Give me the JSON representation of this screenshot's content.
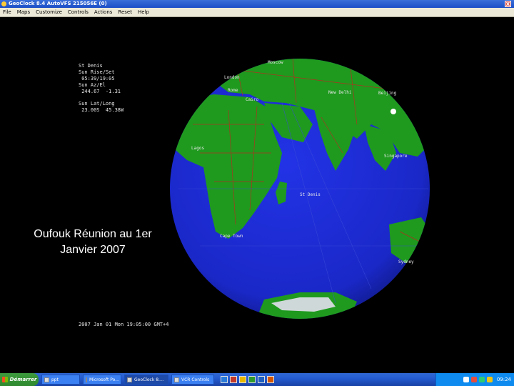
{
  "window": {
    "title": "GeoClock 8.4     AutoVFS 215056E (0)",
    "close_label": "X"
  },
  "menu": [
    "File",
    "Maps",
    "Customize",
    "Controls",
    "Actions",
    "Reset",
    "Help"
  ],
  "info_panel": {
    "city": "St Denis",
    "rise_set_label": "Sun Rise/Set",
    "rise_set_value": " 05:39/19:05",
    "az_el_label": "Sun Az/El",
    "az_el_value": " 244.67  -1.31",
    "lat_long_label": "Sun Lat/Long",
    "lat_long_value": " 23.00S  45.38W"
  },
  "caption": {
    "line1": "Oufouk Réunion au 1er",
    "line2": "Janvier 2007"
  },
  "datetime": "2007 Jan 01 Mon 19:05:00 GMT+4",
  "cities": {
    "moscow": "Moscow",
    "london": "London",
    "rome": "Rome",
    "cairo": "Cairo",
    "new_delhi": "New Delhi",
    "beijing": "Beijing",
    "lagos": "Lagos",
    "singapore": "Singapore",
    "st_denis": "St Denis",
    "cape_town": "Cape Town",
    "sydney": "Sydney"
  },
  "taskbar": {
    "start_label": "Démarrer",
    "tasks": [
      "ppt",
      "Microsoft Po...",
      "GeoClock 8....",
      "VCR Controls"
    ],
    "clock": "09:24"
  },
  "colors": {
    "ocean": "#1b2bd6",
    "land": "#1f9a1f",
    "border_lines": "#c82020",
    "ice": "#cfd8d8",
    "background": "#000000"
  }
}
